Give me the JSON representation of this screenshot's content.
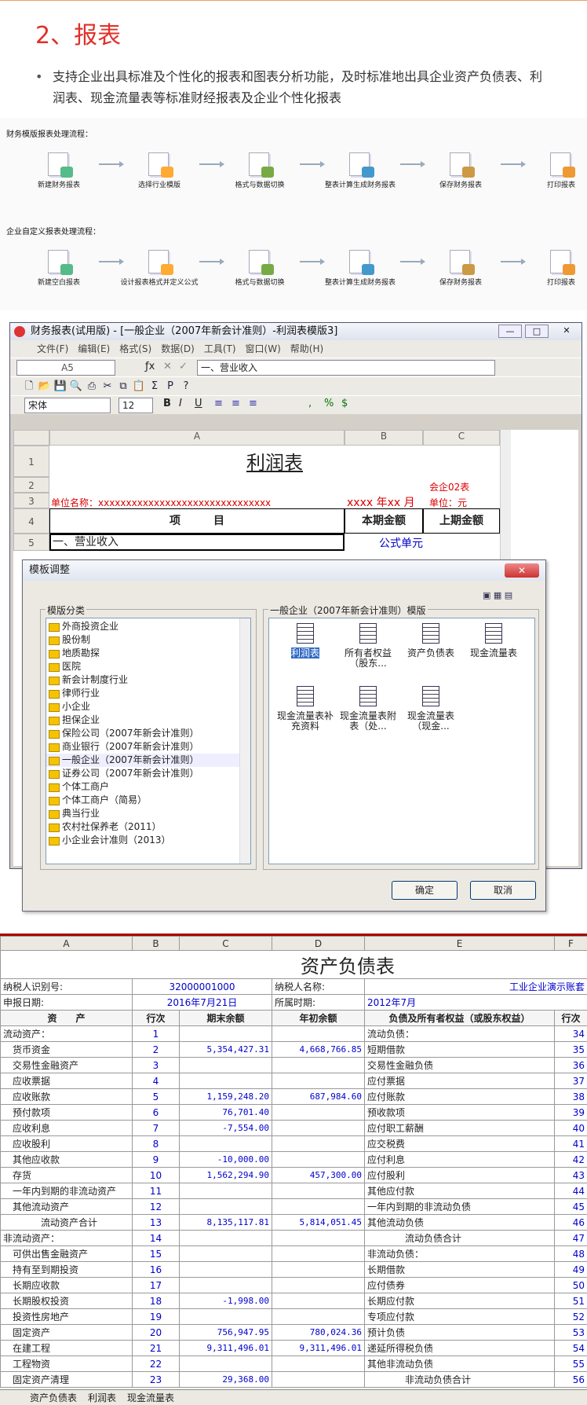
{
  "heading": "2、报表",
  "bullet": "支持企业出具标准及个性化的报表和图表分析功能，及时标准地出具企业资产负债表、利润表、现金流量表等标准财经报表及企业个性化报表",
  "flow1": {
    "label": "财务模版报表处理流程：",
    "steps": [
      "新建财务报表",
      "选择行业模版",
      "格式与数据切换",
      "整表计算生成财务报表",
      "保存财务报表",
      "打印报表"
    ]
  },
  "flow2": {
    "label": "企业自定义报表处理流程：",
    "steps": [
      "新建空白报表",
      "设计报表格式并定义公式",
      "格式与数据切换",
      "整表计算生成财务报表",
      "保存财务报表",
      "打印报表"
    ]
  },
  "app": {
    "title": "财务报表(试用版) - [一般企业（2007年新会计准则）-利润表模版3]",
    "menu": [
      "文件(F)",
      "编辑(E)",
      "格式(S)",
      "数据(D)",
      "工具(T)",
      "窗口(W)",
      "帮助(H)"
    ],
    "cellref": "A5",
    "formula": "一、营业收入",
    "font": "宋体",
    "size": "12",
    "cols": [
      "A",
      "B",
      "C"
    ],
    "rows": [
      "1",
      "2",
      "3",
      "4",
      "5"
    ],
    "sheet_title": "利润表",
    "code": "会企02表",
    "unit_name": "单位名称：xxxxxxxxxxxxxxxxxxxxxxxxxxxxxxx",
    "period": "xxxx 年xx 月",
    "unit": "单位：元",
    "h_item": "项　　　目",
    "h_cur": "本期金额",
    "h_prev": "上期金额",
    "row5": "一、营业收入",
    "row5b": "公式单元"
  },
  "dialog": {
    "title": "模板调整",
    "left_group": "模版分类",
    "right_group": "一般企业（2007年新会计准则）模版",
    "tree": [
      "外商投资企业",
      "股份制",
      "地质勘探",
      "医院",
      "新会计制度行业",
      "律师行业",
      "小企业",
      "担保企业",
      "保险公司（2007年新会计准则）",
      "商业银行（2007年新会计准则）",
      "一般企业（2007年新会计准则）",
      "证券公司（2007年新会计准则）",
      "个体工商户",
      "个体工商户（简易）",
      "典当行业",
      "农村社保养老（2011）",
      "小企业会计准则（2013）"
    ],
    "templates": [
      "利润表",
      "所有者权益（股东...",
      "资产负债表",
      "现金流量表",
      "现金流量表补充资料",
      "现金流量表附表（处...",
      "现金流量表（现金..."
    ],
    "ok": "确定",
    "cancel": "取消"
  },
  "bs": {
    "cols": [
      "A",
      "B",
      "C",
      "D",
      "E",
      "F"
    ],
    "title": "资产负债表",
    "taxid_label": "纳税人识别号:",
    "taxid": "32000001000",
    "taxname_label": "纳税人名称:",
    "taxname": "工业企业演示账套",
    "date_label": "申报日期:",
    "date": "2016年7月21日",
    "period_label": "所属时期:",
    "period": "2012年7月",
    "headers": [
      "资　　产",
      "行次",
      "期末余额",
      "年初余额",
      "负债及所有者权益（或股东权益）",
      "行次"
    ],
    "rows": [
      [
        "流动资产：",
        "1",
        "",
        "",
        "流动负债：",
        "34"
      ],
      [
        "　货币资金",
        "2",
        "5,354,427.31",
        "4,668,766.85",
        "短期借款",
        "35"
      ],
      [
        "　交易性金融资产",
        "3",
        "",
        "",
        "交易性金融负债",
        "36"
      ],
      [
        "　应收票据",
        "4",
        "",
        "",
        "应付票据",
        "37"
      ],
      [
        "　应收账款",
        "5",
        "1,159,248.20",
        "687,984.60",
        "应付账款",
        "38"
      ],
      [
        "　预付款项",
        "6",
        "76,701.40",
        "",
        "预收款项",
        "39"
      ],
      [
        "　应收利息",
        "7",
        "-7,554.00",
        "",
        "应付职工薪酬",
        "40"
      ],
      [
        "　应收股利",
        "8",
        "",
        "",
        "应交税费",
        "41"
      ],
      [
        "　其他应收款",
        "9",
        "-10,000.00",
        "",
        "应付利息",
        "42"
      ],
      [
        "　存货",
        "10",
        "1,562,294.90",
        "457,300.00",
        "应付股利",
        "43"
      ],
      [
        "　一年内到期的非流动资产",
        "11",
        "",
        "",
        "其他应付款",
        "44"
      ],
      [
        "　其他流动资产",
        "12",
        "",
        "",
        "一年内到期的非流动负债",
        "45"
      ],
      [
        "　　　　流动资产合计",
        "13",
        "8,135,117.81",
        "5,814,051.45",
        "其他流动负债",
        "46"
      ],
      [
        "非流动资产：",
        "14",
        "",
        "",
        "　　　　流动负债合计",
        "47"
      ],
      [
        "　可供出售金融资产",
        "15",
        "",
        "",
        "非流动负债：",
        "48"
      ],
      [
        "　持有至到期投资",
        "16",
        "",
        "",
        "长期借款",
        "49"
      ],
      [
        "　长期应收款",
        "17",
        "",
        "",
        "应付债券",
        "50"
      ],
      [
        "　长期股权投资",
        "18",
        "-1,998.00",
        "",
        "长期应付款",
        "51"
      ],
      [
        "　投资性房地产",
        "19",
        "",
        "",
        "专项应付款",
        "52"
      ],
      [
        "　固定资产",
        "20",
        "756,947.95",
        "780,024.36",
        "预计负债",
        "53"
      ],
      [
        "　在建工程",
        "21",
        "9,311,496.01",
        "9,311,496.01",
        "递延所得税负债",
        "54"
      ],
      [
        "　工程物资",
        "22",
        "",
        "",
        "其他非流动负债",
        "55"
      ],
      [
        "　固定资产清理",
        "23",
        "29,368.00",
        "",
        "　　　　非流动负债合计",
        "56"
      ]
    ],
    "tabs": [
      "资产负债表",
      "利润表",
      "现金流量表"
    ]
  }
}
